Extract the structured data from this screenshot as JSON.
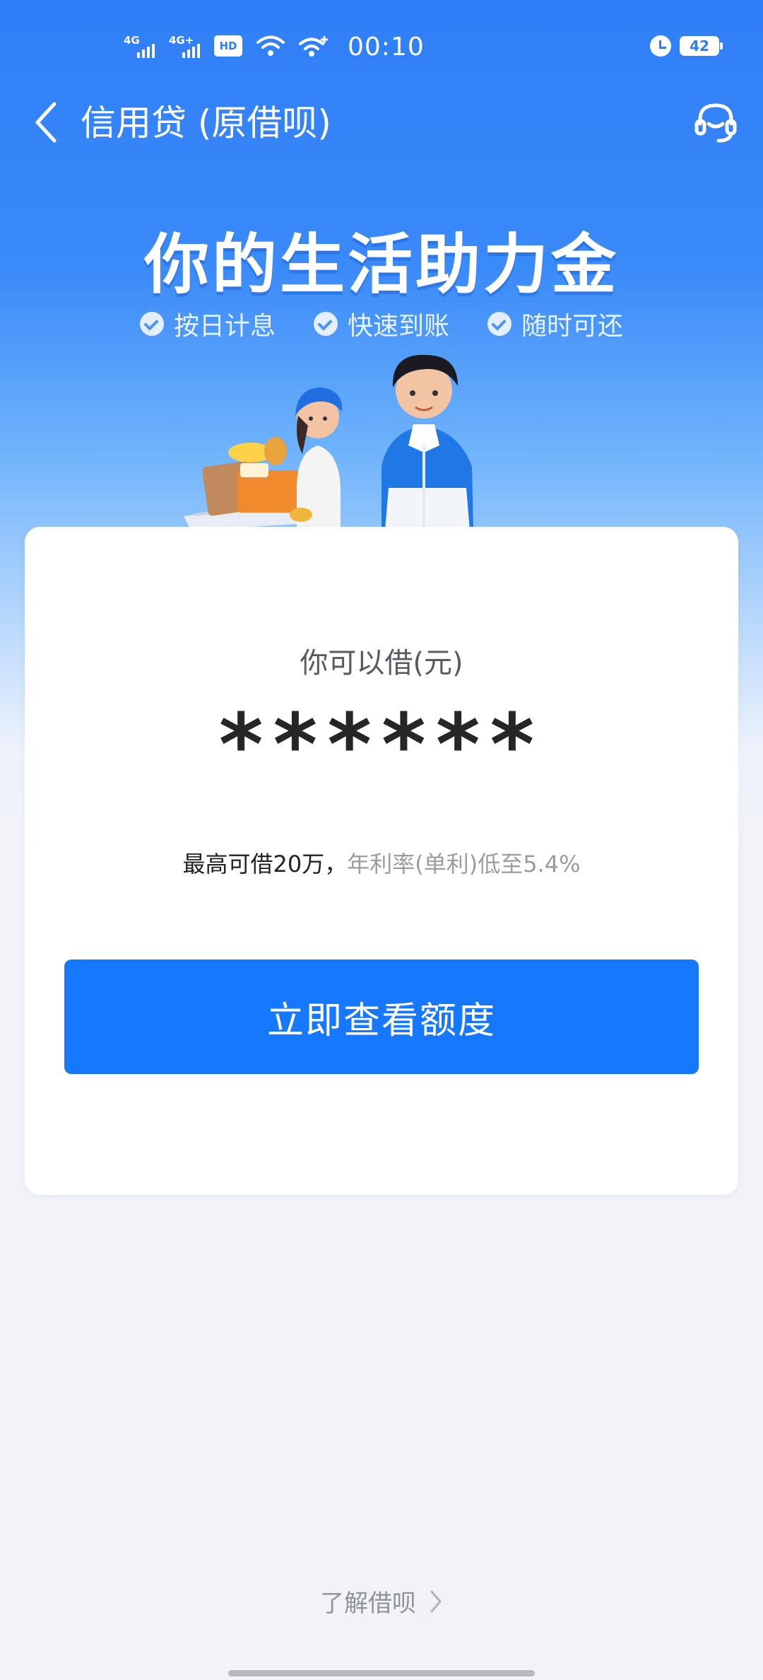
{
  "status_bar": {
    "signal1_label": "4G",
    "signal2_label": "4G+",
    "hd_label": "HD",
    "time": "00:10",
    "battery": "42"
  },
  "nav": {
    "title": "信用贷 (原借呗)",
    "back_icon": "chevron-left-icon",
    "service_icon": "headset-icon"
  },
  "hero": {
    "title": "你的生活助力金",
    "features": [
      "按日计息",
      "快速到账",
      "随时可还"
    ]
  },
  "card": {
    "amount_label": "你可以借(元)",
    "amount_value": "******",
    "max_text": "最高可借20万，",
    "rate_text": "年利率(单利)低至5.4%",
    "cta_label": "立即查看额度"
  },
  "footer": {
    "learn_label": "了解借呗"
  },
  "colors": {
    "brand_blue": "#1677ff",
    "header_blue": "#2f7ef8",
    "page_bg": "#f2f3f8"
  }
}
